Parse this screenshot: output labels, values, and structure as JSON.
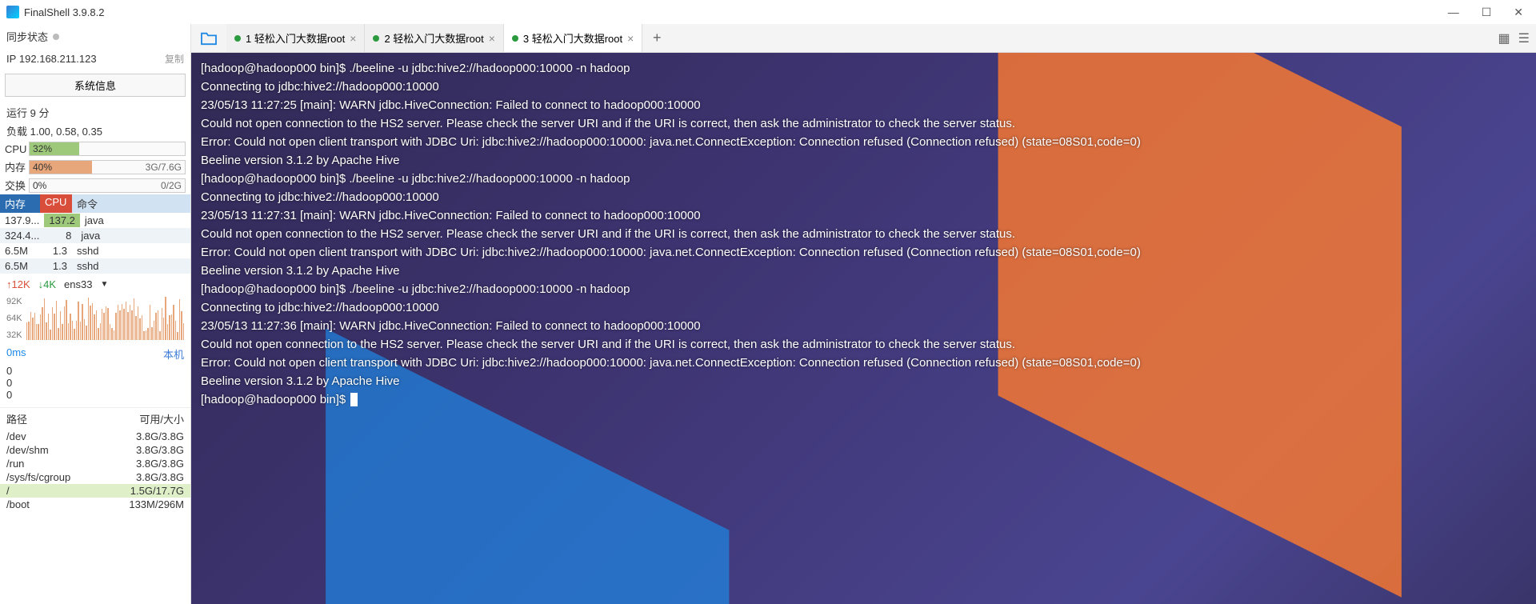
{
  "title": "FinalShell 3.9.8.2",
  "sidebar": {
    "sync_label": "同步状态",
    "ip_label": "IP",
    "ip_value": "192.168.211.123",
    "copy_label": "复制",
    "sysinfo_btn": "系统信息",
    "uptime": "运行 9 分",
    "loadavg": "负载 1.00, 0.58, 0.35",
    "cpu": {
      "label": "CPU",
      "pct": "32%",
      "fill": 32,
      "color": "#9ec97a"
    },
    "mem": {
      "label": "内存",
      "pct": "40%",
      "fill": 40,
      "color": "#e8a77a",
      "rt": "3G/7.6G"
    },
    "swap": {
      "label": "交换",
      "pct": "0%",
      "fill": 0,
      "color": "#ccc",
      "rt": "0/2G"
    },
    "proc_headers": {
      "mem": "内存",
      "cpu": "CPU",
      "cmd": "命令"
    },
    "procs": [
      {
        "mem": "137.9...",
        "cpu": "137.2",
        "cmd": "java",
        "hi": true
      },
      {
        "mem": "324.4...",
        "cpu": "8",
        "cmd": "java"
      },
      {
        "mem": "6.5M",
        "cpu": "1.3",
        "cmd": "sshd"
      },
      {
        "mem": "6.5M",
        "cpu": "1.3",
        "cmd": "sshd"
      }
    ],
    "net": {
      "up": "↑12K",
      "dn": "↓4K",
      "iface": "ens33",
      "axis": [
        "92K",
        "64K",
        "32K"
      ]
    },
    "lat": {
      "ms": "0ms",
      "host": "本机",
      "rows": [
        "0",
        "0",
        "0"
      ]
    },
    "disk_headers": {
      "path": "路径",
      "size": "可用/大小"
    },
    "disks": [
      {
        "path": "/dev",
        "size": "3.8G/3.8G"
      },
      {
        "path": "/dev/shm",
        "size": "3.8G/3.8G"
      },
      {
        "path": "/run",
        "size": "3.8G/3.8G"
      },
      {
        "path": "/sys/fs/cgroup",
        "size": "3.8G/3.8G"
      },
      {
        "path": "/",
        "size": "1.5G/17.7G",
        "hl": true
      },
      {
        "path": "/boot",
        "size": "133M/296M"
      }
    ]
  },
  "tabs": [
    {
      "num": "1",
      "label": "轻松入门大数据root",
      "active": false
    },
    {
      "num": "2",
      "label": "轻松入门大数据root",
      "active": false
    },
    {
      "num": "3",
      "label": "轻松入门大数据root",
      "active": true
    }
  ],
  "terminal": "[hadoop@hadoop000 bin]$ ./beeline -u jdbc:hive2://hadoop000:10000 -n hadoop\nConnecting to jdbc:hive2://hadoop000:10000\n23/05/13 11:27:25 [main]: WARN jdbc.HiveConnection: Failed to connect to hadoop000:10000\nCould not open connection to the HS2 server. Please check the server URI and if the URI is correct, then ask the administrator to check the server status.\nError: Could not open client transport with JDBC Uri: jdbc:hive2://hadoop000:10000: java.net.ConnectException: Connection refused (Connection refused) (state=08S01,code=0)\nBeeline version 3.1.2 by Apache Hive\n[hadoop@hadoop000 bin]$ ./beeline -u jdbc:hive2://hadoop000:10000 -n hadoop\nConnecting to jdbc:hive2://hadoop000:10000\n23/05/13 11:27:31 [main]: WARN jdbc.HiveConnection: Failed to connect to hadoop000:10000\nCould not open connection to the HS2 server. Please check the server URI and if the URI is correct, then ask the administrator to check the server status.\nError: Could not open client transport with JDBC Uri: jdbc:hive2://hadoop000:10000: java.net.ConnectException: Connection refused (Connection refused) (state=08S01,code=0)\nBeeline version 3.1.2 by Apache Hive\n[hadoop@hadoop000 bin]$ ./beeline -u jdbc:hive2://hadoop000:10000 -n hadoop\nConnecting to jdbc:hive2://hadoop000:10000\n23/05/13 11:27:36 [main]: WARN jdbc.HiveConnection: Failed to connect to hadoop000:10000\nCould not open connection to the HS2 server. Please check the server URI and if the URI is correct, then ask the administrator to check the server status.\nError: Could not open client transport with JDBC Uri: jdbc:hive2://hadoop000:10000: java.net.ConnectException: Connection refused (Connection refused) (state=08S01,code=0)\nBeeline version 3.1.2 by Apache Hive\n[hadoop@hadoop000 bin]$ "
}
